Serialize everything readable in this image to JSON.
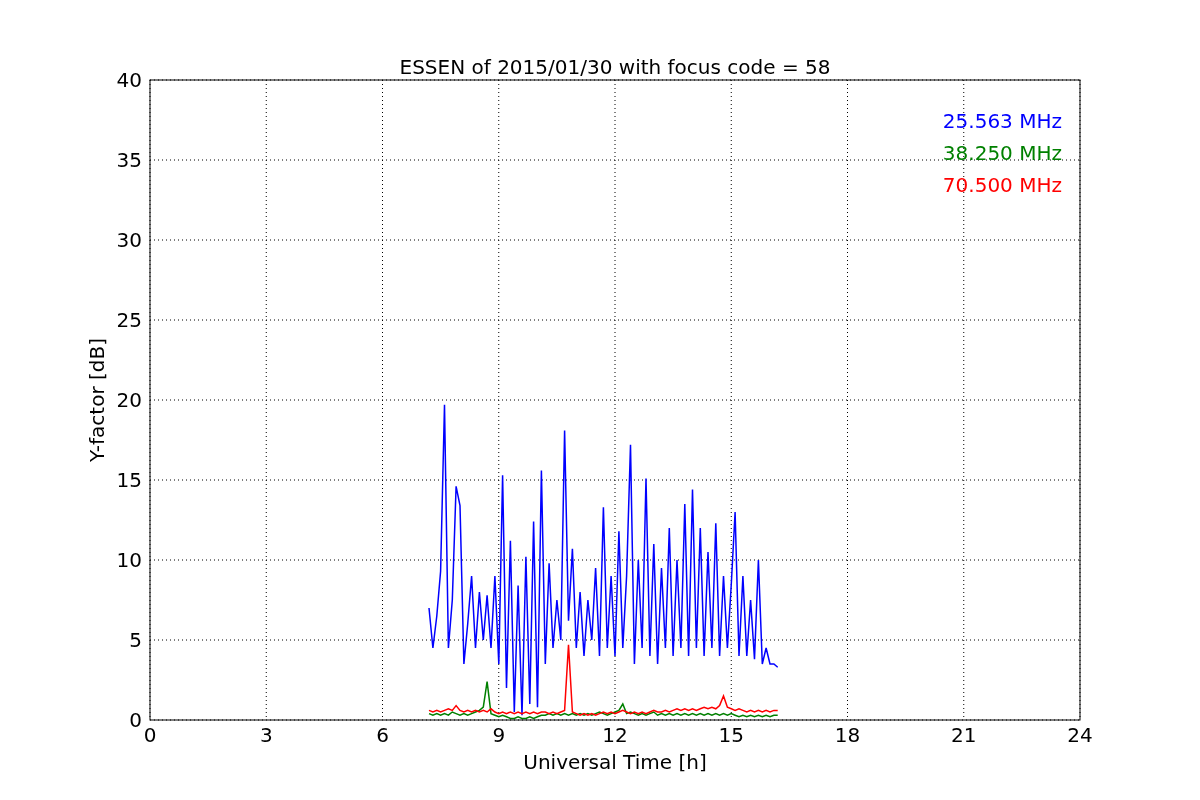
{
  "figure": {
    "chart_data": {
      "type": "line",
      "title": "ESSEN of 2015/01/30 with focus code = 58",
      "xlabel": "Universal Time [h]",
      "ylabel": "Y-factor [dB]",
      "grid": true,
      "xlim": [
        0,
        24
      ],
      "ylim": [
        0,
        40
      ],
      "xticks": [
        0,
        3,
        6,
        9,
        12,
        15,
        18,
        21,
        24
      ],
      "yticks": [
        0,
        5,
        10,
        15,
        20,
        25,
        30,
        35,
        40
      ],
      "x": [
        7.2,
        7.3,
        7.4,
        7.5,
        7.6,
        7.7,
        7.8,
        7.9,
        8.0,
        8.1,
        8.2,
        8.3,
        8.4,
        8.5,
        8.6,
        8.7,
        8.8,
        8.9,
        9.0,
        9.1,
        9.2,
        9.3,
        9.4,
        9.5,
        9.6,
        9.7,
        9.8,
        9.9,
        10.0,
        10.1,
        10.2,
        10.3,
        10.4,
        10.5,
        10.6,
        10.7,
        10.8,
        10.9,
        11.0,
        11.1,
        11.2,
        11.3,
        11.4,
        11.5,
        11.6,
        11.7,
        11.8,
        11.9,
        12.0,
        12.1,
        12.2,
        12.3,
        12.4,
        12.5,
        12.6,
        12.7,
        12.8,
        12.9,
        13.0,
        13.1,
        13.2,
        13.3,
        13.4,
        13.5,
        13.6,
        13.7,
        13.8,
        13.9,
        14.0,
        14.1,
        14.2,
        14.3,
        14.4,
        14.5,
        14.6,
        14.7,
        14.8,
        14.9,
        15.0,
        15.1,
        15.2,
        15.3,
        15.4,
        15.5,
        15.6,
        15.7,
        15.8,
        15.9,
        16.0,
        16.1,
        16.2
      ],
      "series": [
        {
          "name": "25.563 MHz",
          "color": "#0000ff",
          "values": [
            7.0,
            4.5,
            6.5,
            9.3,
            19.7,
            4.5,
            7.5,
            14.6,
            13.4,
            3.5,
            6.0,
            9.0,
            4.5,
            8.0,
            5.0,
            7.8,
            4.5,
            9.0,
            3.5,
            15.3,
            2.0,
            11.2,
            0.5,
            8.4,
            0.3,
            10.2,
            1.0,
            12.4,
            0.8,
            15.6,
            3.5,
            9.8,
            4.5,
            7.5,
            5.0,
            18.1,
            6.2,
            10.7,
            4.5,
            8.0,
            4.0,
            7.5,
            5.0,
            9.5,
            4.0,
            13.3,
            4.5,
            9.0,
            4.0,
            11.8,
            4.5,
            9.0,
            17.2,
            3.5,
            10.0,
            4.5,
            15.1,
            4.0,
            11.0,
            3.5,
            9.5,
            4.5,
            12.0,
            4.0,
            10.0,
            4.5,
            13.5,
            4.0,
            14.4,
            4.5,
            12.0,
            4.0,
            10.5,
            4.5,
            12.3,
            4.0,
            9.0,
            4.5,
            8.5,
            13.0,
            4.0,
            9.0,
            4.0,
            7.5,
            3.8,
            10.0,
            3.5,
            4.5,
            3.5,
            3.5,
            3.3
          ]
        },
        {
          "name": "38.250 MHz",
          "color": "#008000",
          "values": [
            0.4,
            0.3,
            0.4,
            0.3,
            0.4,
            0.3,
            0.5,
            0.4,
            0.3,
            0.4,
            0.3,
            0.4,
            0.5,
            0.6,
            0.8,
            2.4,
            0.4,
            0.3,
            0.2,
            0.3,
            0.2,
            0.1,
            0.1,
            0.2,
            0.1,
            0.1,
            0.2,
            0.1,
            0.2,
            0.3,
            0.3,
            0.4,
            0.3,
            0.4,
            0.3,
            0.4,
            0.3,
            0.4,
            0.3,
            0.4,
            0.3,
            0.4,
            0.3,
            0.4,
            0.5,
            0.4,
            0.3,
            0.4,
            0.5,
            0.6,
            1.0,
            0.4,
            0.5,
            0.4,
            0.3,
            0.4,
            0.3,
            0.4,
            0.5,
            0.3,
            0.4,
            0.3,
            0.4,
            0.3,
            0.4,
            0.3,
            0.4,
            0.3,
            0.4,
            0.3,
            0.4,
            0.3,
            0.4,
            0.3,
            0.4,
            0.3,
            0.4,
            0.3,
            0.4,
            0.3,
            0.2,
            0.3,
            0.2,
            0.3,
            0.2,
            0.3,
            0.2,
            0.3,
            0.2,
            0.3,
            0.3
          ]
        },
        {
          "name": "70.500 MHz",
          "color": "#ff0000",
          "values": [
            0.6,
            0.5,
            0.6,
            0.5,
            0.6,
            0.7,
            0.6,
            0.9,
            0.6,
            0.5,
            0.6,
            0.5,
            0.6,
            0.5,
            0.6,
            0.5,
            0.7,
            0.5,
            0.4,
            0.5,
            0.4,
            0.5,
            0.4,
            0.5,
            0.4,
            0.5,
            0.4,
            0.5,
            0.4,
            0.5,
            0.5,
            0.4,
            0.5,
            0.4,
            0.5,
            0.6,
            4.7,
            0.5,
            0.4,
            0.3,
            0.4,
            0.3,
            0.4,
            0.3,
            0.4,
            0.5,
            0.4,
            0.5,
            0.4,
            0.5,
            0.6,
            0.5,
            0.4,
            0.5,
            0.4,
            0.5,
            0.4,
            0.5,
            0.6,
            0.5,
            0.5,
            0.6,
            0.5,
            0.6,
            0.7,
            0.6,
            0.7,
            0.6,
            0.7,
            0.6,
            0.7,
            0.8,
            0.7,
            0.8,
            0.7,
            0.9,
            1.5,
            0.8,
            0.7,
            0.6,
            0.7,
            0.6,
            0.5,
            0.6,
            0.5,
            0.6,
            0.5,
            0.6,
            0.5,
            0.6,
            0.6
          ]
        }
      ]
    }
  }
}
